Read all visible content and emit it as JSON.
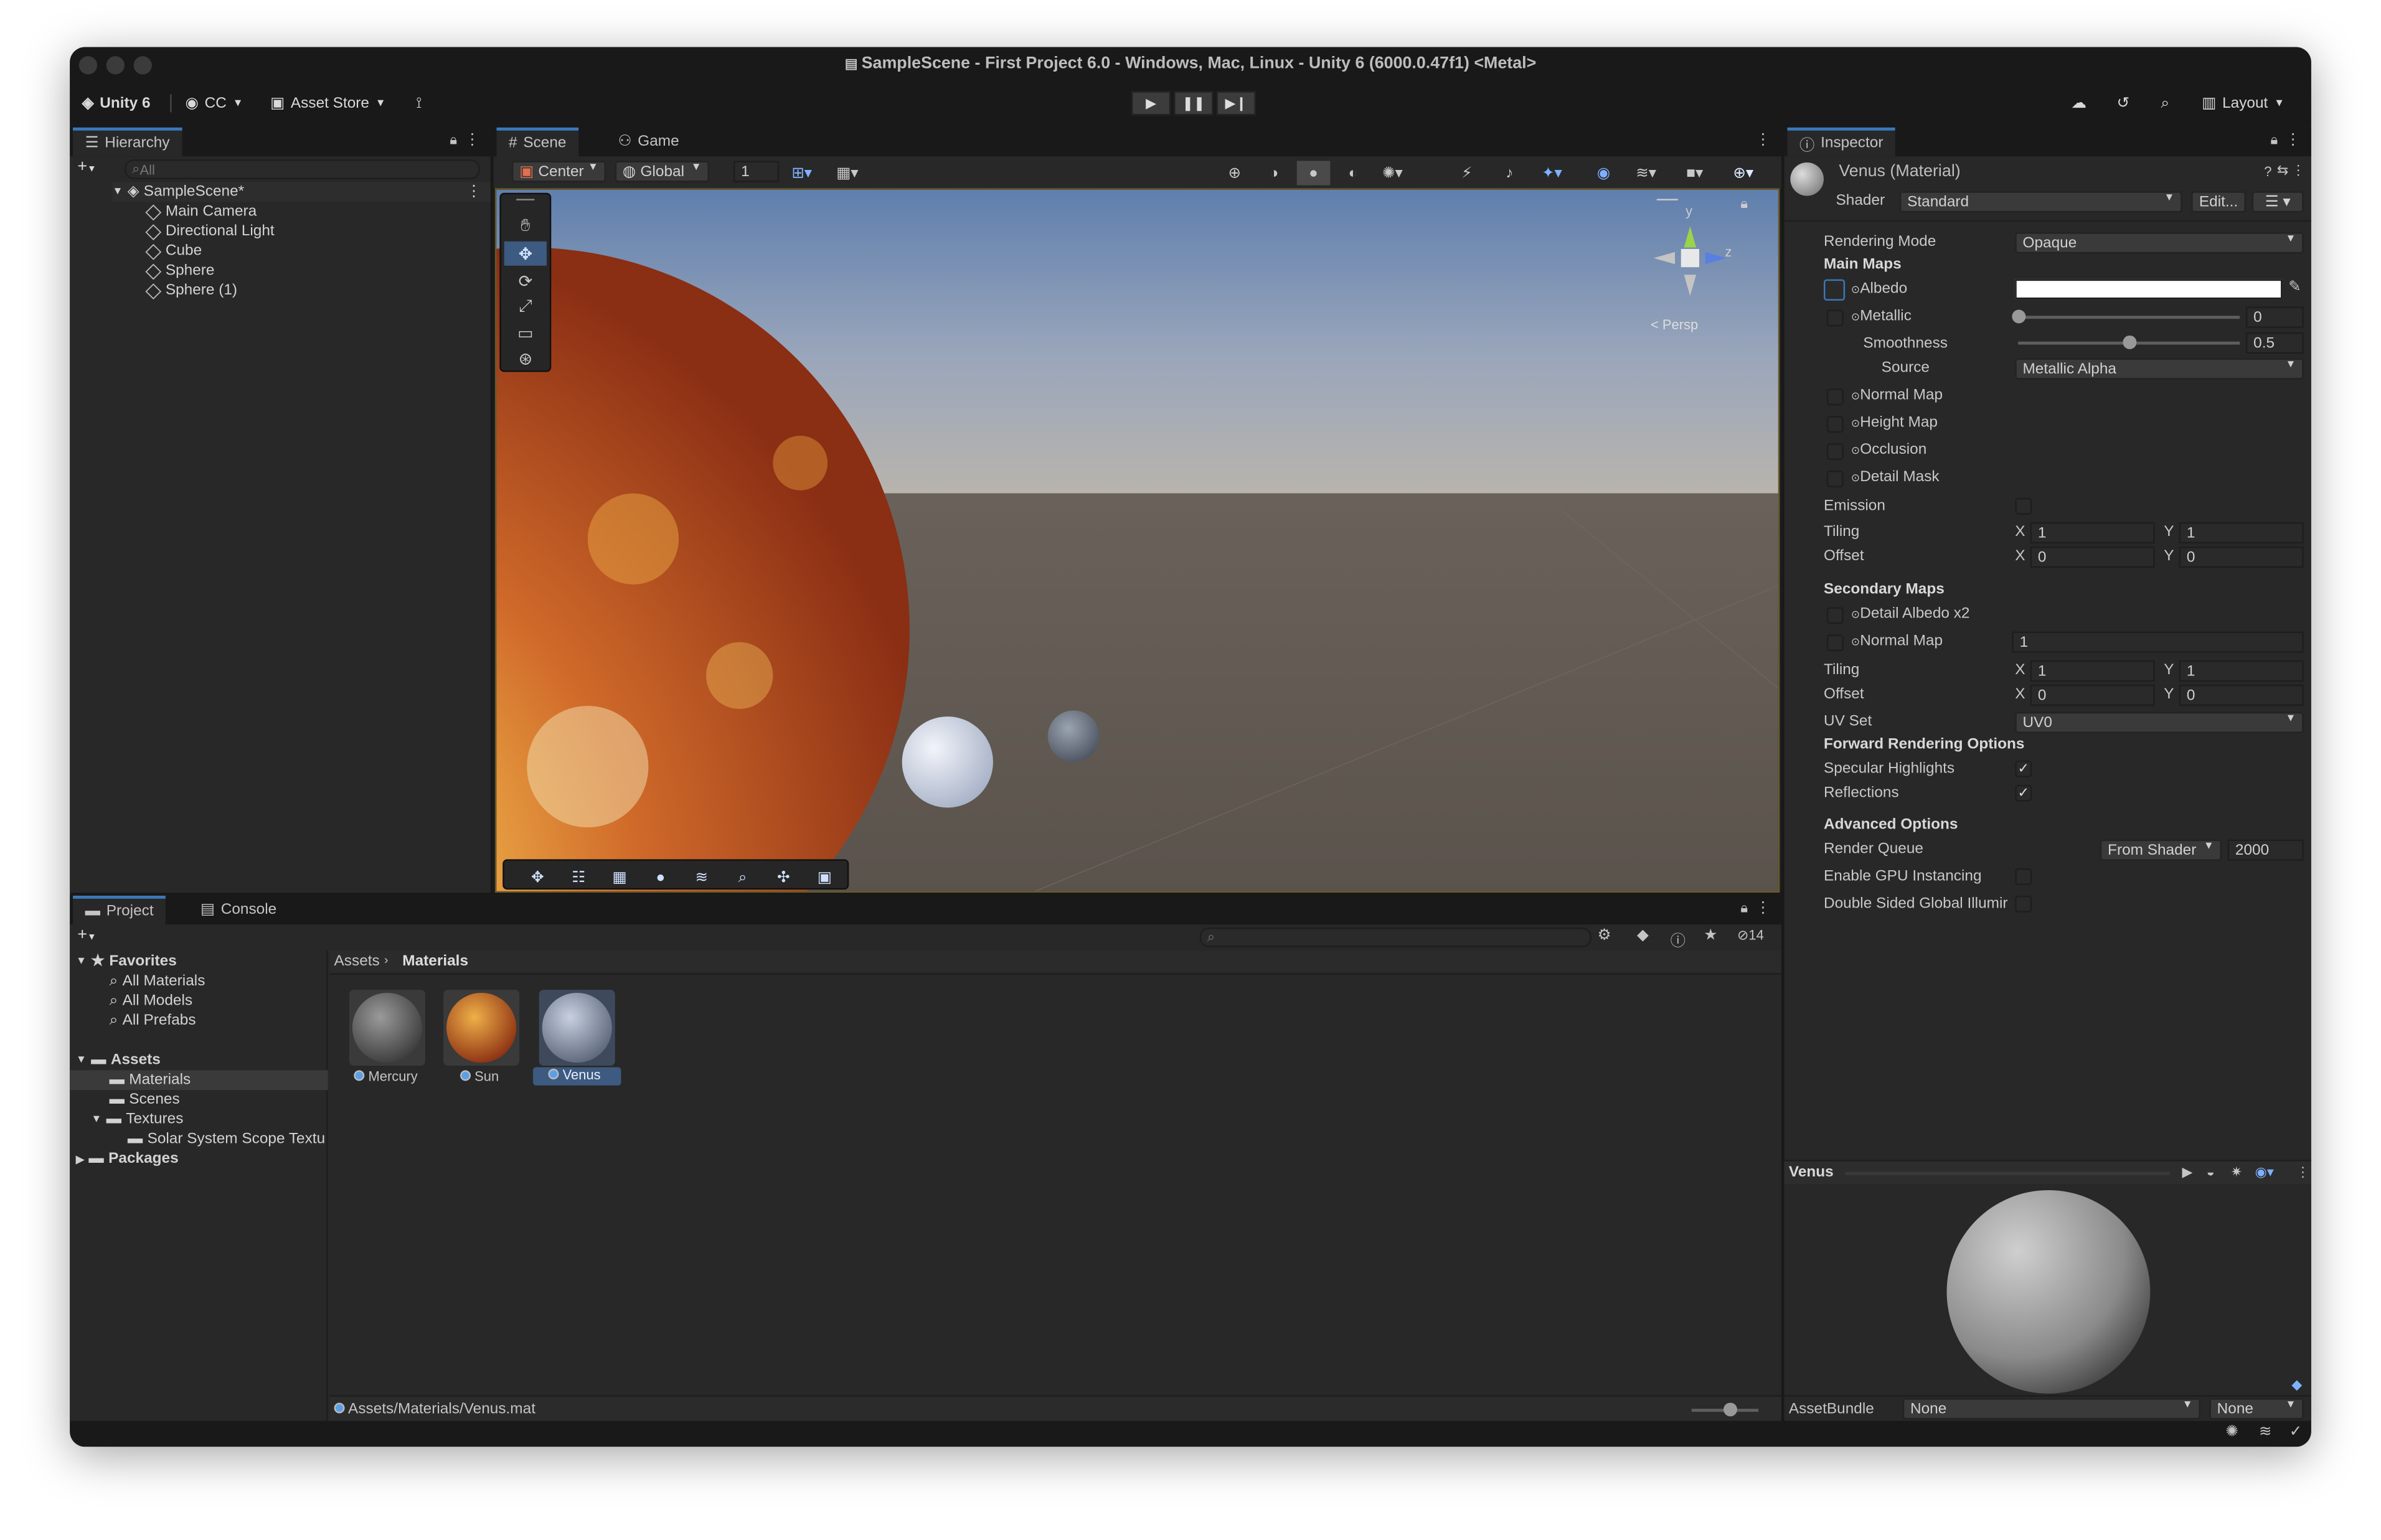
{
  "window": {
    "title": "SampleScene - First Project 6.0 - Windows, Mac, Linux - Unity 6 (6000.0.47f1) <Metal>"
  },
  "toolbar": {
    "unity_label": "Unity 6",
    "account_label": "CC",
    "asset_store_label": "Asset Store",
    "layout_label": "Layout"
  },
  "hierarchy": {
    "tab_label": "Hierarchy",
    "search_placeholder": "All",
    "scene_name": "SampleScene*",
    "items": [
      "Main Camera",
      "Directional Light",
      "Cube",
      "Sphere",
      "Sphere (1)"
    ]
  },
  "scene_view": {
    "tabs": [
      "Scene",
      "Game"
    ],
    "pivot_label": "Center",
    "space_label": "Global",
    "grid_value": "1",
    "gizmo_y": "y",
    "gizmo_z": "z",
    "persp_label": "< Persp"
  },
  "project": {
    "tabs": [
      "Project",
      "Console"
    ],
    "favorites_label": "Favorites",
    "favorites": [
      "All Materials",
      "All Models",
      "All Prefabs"
    ],
    "assets_label": "Assets",
    "asset_folders": [
      "Materials",
      "Scenes",
      "Textures"
    ],
    "texture_subfolder": "Solar System Scope Textu",
    "packages_label": "Packages",
    "breadcrumb": [
      "Assets",
      "Materials"
    ],
    "count": "14",
    "materials": [
      "Mercury",
      "Sun",
      "Venus"
    ],
    "status_path": "Assets/Materials/Venus.mat"
  },
  "inspector": {
    "tab_label": "Inspector",
    "material_name": "Venus (Material)",
    "shader_label": "Shader",
    "shader_value": "Standard",
    "edit_label": "Edit...",
    "rendering_mode_label": "Rendering Mode",
    "rendering_mode_value": "Opaque",
    "main_maps_label": "Main Maps",
    "albedo_label": "Albedo",
    "metallic_label": "Metallic",
    "metallic_value": "0",
    "metallic_level": 0,
    "smoothness_label": "Smoothness",
    "smoothness_value": "0.5",
    "smoothness_level": 0.5,
    "source_label": "Source",
    "source_value": "Metallic Alpha",
    "normal_map_label": "Normal Map",
    "height_map_label": "Height Map",
    "occlusion_label": "Occlusion",
    "detail_mask_label": "Detail Mask",
    "emission_label": "Emission",
    "tiling_label": "Tiling",
    "offset_label": "Offset",
    "x_label": "X",
    "y_label": "Y",
    "main_tiling": {
      "x": "1",
      "y": "1"
    },
    "main_offset": {
      "x": "0",
      "y": "0"
    },
    "secondary_maps_label": "Secondary Maps",
    "detail_albedo_label": "Detail Albedo x2",
    "secondary_normal_label": "Normal Map",
    "secondary_normal_value": "1",
    "secondary_tiling": {
      "x": "1",
      "y": "1"
    },
    "secondary_offset": {
      "x": "0",
      "y": "0"
    },
    "uv_set_label": "UV Set",
    "uv_set_value": "UV0",
    "forward_label": "Forward Rendering Options",
    "specular_label": "Specular Highlights",
    "reflections_label": "Reflections",
    "advanced_label": "Advanced Options",
    "render_queue_label": "Render Queue",
    "render_queue_source": "From Shader",
    "render_queue_value": "2000",
    "gpu_instancing_label": "Enable GPU Instancing",
    "double_sided_label": "Double Sided Global Illumir",
    "preview_label": "Venus",
    "assetbundle_label": "AssetBundle",
    "assetbundle_value": "None",
    "assetbundle_variant": "None"
  },
  "colors": {
    "accent": "#3a79bb",
    "background": "#282828",
    "dark": "#191919"
  }
}
